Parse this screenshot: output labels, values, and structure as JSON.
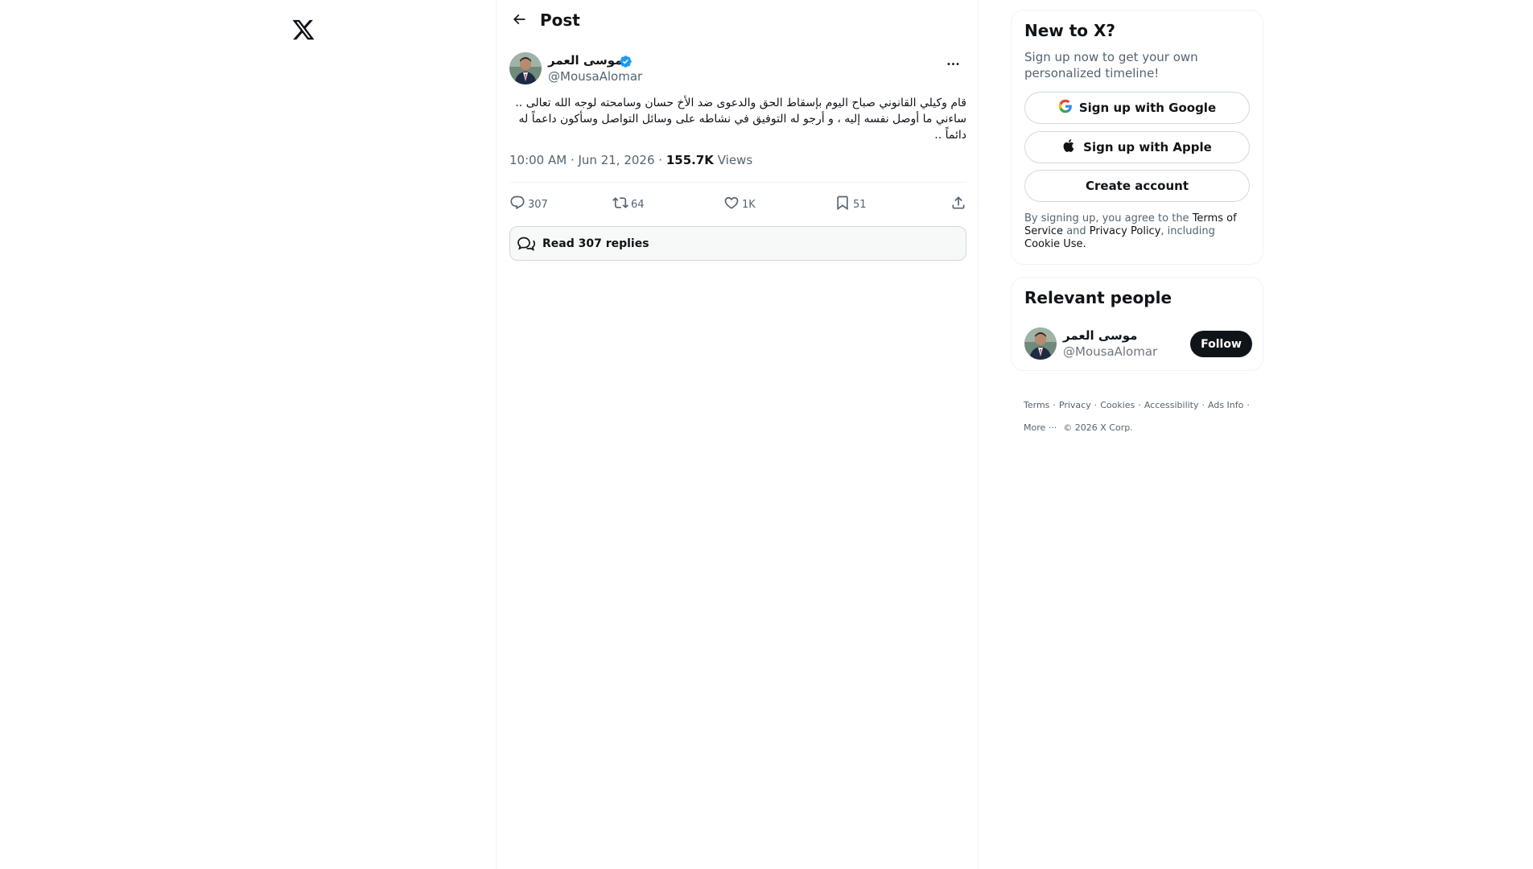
{
  "header": {
    "title": "Post"
  },
  "post": {
    "author_name": "موسى العمر",
    "author_handle": "@MousaAlomar",
    "text": "قام وكيلي القانوني صباح اليوم بإسقاط الحق والدعوى ضد الأخ حسان وسامحته لوجه الله تعالى .. ساءني ما أوصل نفسه إليه ، و أرجو له التوفيق في نشاطه على وسائل التواصل وسأكون داعماً له دائماً ..",
    "time": "10:00 AM · Jun 21, 2026",
    "views_count": "155.7K",
    "views_label": "Views",
    "separator": "·"
  },
  "actions": {
    "replies": "307",
    "reposts": "64",
    "likes": "1K",
    "bookmarks": "51"
  },
  "read_replies": {
    "label": "Read 307 replies"
  },
  "sidebar": {
    "new_to_x": {
      "title": "New to X?",
      "subtitle": "Sign up now to get your own personalized timeline!",
      "google_label": "Sign up with Google",
      "apple_label": "Sign up with Apple",
      "create_label": "Create account",
      "legal_prefix": "By signing up, you agree to the",
      "terms_link": "Terms of Service",
      "legal_and": "and",
      "privacy_link": "Privacy Policy",
      "legal_including": ", including",
      "cookie_link": "Cookie Use."
    },
    "relevant_people": {
      "title": "Relevant people",
      "name": "موسى العمر",
      "handle": "@MousaAlomar",
      "follow_label": "Follow"
    },
    "footer": {
      "links": [
        "Terms",
        "Privacy",
        "Cookies",
        "Accessibility",
        "Ads Info",
        "More ···"
      ],
      "copyright": "© 2026 X Corp.",
      "dot": "·"
    }
  },
  "colors": {
    "text_primary": "#0f1419",
    "text_secondary": "#536471",
    "border": "#eff3f4",
    "verified": "#1d9bf0",
    "button_dark": "#0f1419"
  },
  "icons": [
    "x-logo-icon",
    "back-arrow-icon",
    "verified-badge-icon",
    "more-dots-icon",
    "reply-icon",
    "repost-icon",
    "like-icon",
    "bookmark-icon",
    "share-icon",
    "speech-bubbles-icon",
    "google-icon",
    "apple-icon"
  ]
}
